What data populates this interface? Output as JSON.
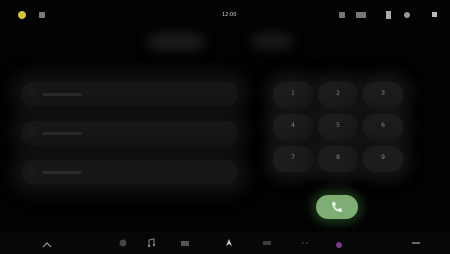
{
  "status_bar": {
    "time": "12:00",
    "app_icons": [
      "app-icon-yellow",
      "app-icon-small"
    ],
    "system_icons": [
      "wifi-icon",
      "signal-icon",
      "battery-icon",
      "settings-icon"
    ]
  },
  "header": {
    "tab_left": "",
    "tab_right": ""
  },
  "section_label": "",
  "contacts": [
    {
      "name": ""
    },
    {
      "name": ""
    },
    {
      "name": ""
    }
  ],
  "dialpad": {
    "keys": [
      "1",
      "2",
      "3",
      "4",
      "5",
      "6",
      "7",
      "8",
      "9"
    ]
  },
  "call_button": {
    "icon": "phone-icon"
  },
  "nav_bar": {
    "items": [
      "back-icon",
      "home-icon",
      "music-icon",
      "navigation-icon",
      "phone-icon",
      "apps-icon"
    ],
    "accent_color": "#7a3a8f",
    "call_color": "#7fae74"
  }
}
